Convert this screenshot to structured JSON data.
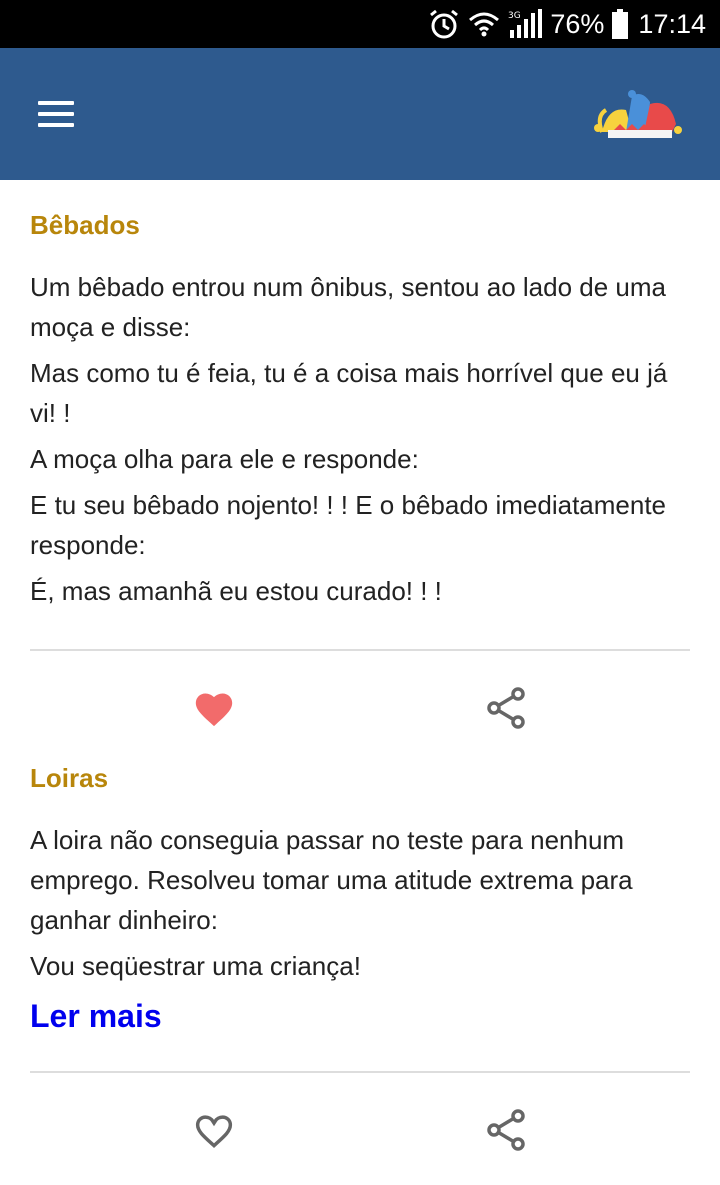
{
  "status_bar": {
    "network_type": "3G",
    "battery_percent": "76%",
    "time": "17:14",
    "icons": [
      "alarm-icon",
      "wifi-icon",
      "signal-icon",
      "battery-icon"
    ]
  },
  "app_bar": {
    "color": "#2e5a8e",
    "menu_icon": "hamburger-menu-icon",
    "logo_icon": "jester-hat-icon"
  },
  "jokes": [
    {
      "title": "Bêbados",
      "paragraphs": [
        "Um bêbado entrou num ônibus, sentou ao lado de uma moça e disse:",
        "Mas como tu é feia, tu é a coisa mais horrível que eu já vi! !",
        "A moça olha para ele e responde:",
        "E tu seu bêbado nojento! ! ! E o bêbado imediatamente responde:",
        "É, mas amanhã eu estou curado! ! !"
      ],
      "liked": true
    },
    {
      "title": "Loiras",
      "paragraphs": [
        "A loira não conseguia passar no teste para nenhum emprego. Resolveu tomar uma atitude extrema para ganhar dinheiro:",
        "Vou seqüestrar uma criança!"
      ],
      "read_more": "Ler mais",
      "liked": false
    }
  ],
  "colors": {
    "title": "#b8860b",
    "link": "#0000ee",
    "heart_filled": "#f26b6b",
    "icon_gray": "#666666"
  }
}
